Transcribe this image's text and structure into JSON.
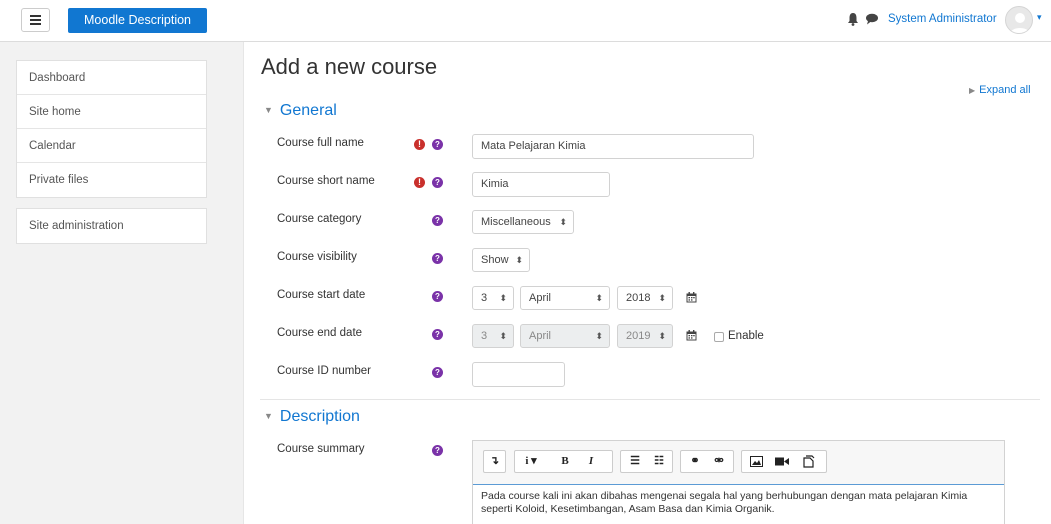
{
  "navbar": {
    "brand": "Moodle Description",
    "user_name": "System Administrator",
    "caret": "▾"
  },
  "sidebar": {
    "items": [
      "Dashboard",
      "Site home",
      "Calendar",
      "Private files"
    ],
    "admin_item": "Site administration"
  },
  "page": {
    "title": "Add a new course",
    "expand_all": "Expand all"
  },
  "general": {
    "heading": "General",
    "full_name_label": "Course full name",
    "full_name_value": "Mata Pelajaran Kimia",
    "short_name_label": "Course short name",
    "short_name_value": "Kimia",
    "category_label": "Course category",
    "category_value": "Miscellaneous",
    "visibility_label": "Course visibility",
    "visibility_value": "Show",
    "start_date_label": "Course start date",
    "start_day": "3",
    "start_month": "April",
    "start_year": "2018",
    "end_date_label": "Course end date",
    "end_day": "3",
    "end_month": "April",
    "end_year": "2019",
    "enable_label": "Enable",
    "id_number_label": "Course ID number",
    "id_number_value": ""
  },
  "description": {
    "heading": "Description",
    "summary_label": "Course summary",
    "summary_line1": "Pada course kali ini akan dibahas mengenai segala hal yang berhubungan dengan mata pelajaran Kimia",
    "summary_line2": "seperti Koloid, Kesetimbangan, Asam Basa dan Kimia Organik."
  },
  "icons": {
    "required": "!",
    "help": "?",
    "select_arrow": "⬍"
  },
  "colors": {
    "accent": "#1177d1",
    "required": "#c9302c",
    "help": "#7a32a8"
  }
}
